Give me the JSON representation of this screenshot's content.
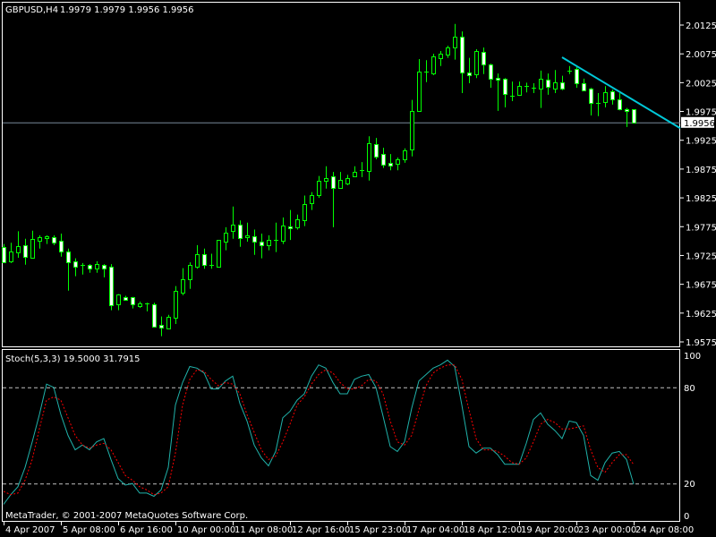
{
  "header": {
    "symbol_timeframe": "GBPUSD,H4",
    "ohlc_text": "1.9979 1.9979 1.9956 1.9956"
  },
  "indicator": {
    "label": "Stoch(5,3,3) 19.5000 31.7915"
  },
  "copyright": "MetaTrader, © 2001-2007 MetaQuotes Software Corp.",
  "colors": {
    "background": "#000000",
    "frame": "#ffffff",
    "candle_outline": "#00ff00",
    "bull_body": "#000000",
    "bear_body": "#ffffff",
    "trendline": "#00c8d8",
    "bid_line": "#778899",
    "stoch_main": "#20b2aa",
    "stoch_signal": "#ff0000",
    "level_line": "#c0c0c0"
  },
  "chart_data": [
    {
      "type": "candlestick",
      "title": "GBPUSD,H4",
      "ylim": [
        1.9575,
        2.0125
      ],
      "price_ticks": [
        "2.0125",
        "2.0075",
        "2.0025",
        "1.9975",
        "1.9925",
        "1.9875",
        "1.9825",
        "1.9775",
        "1.9725",
        "1.9675",
        "1.9625",
        "1.9575"
      ],
      "current_price": "1.9956",
      "time_labels": [
        {
          "bar": 0,
          "text": "4 Apr 2007"
        },
        {
          "bar": 8,
          "text": "5 Apr 08:00"
        },
        {
          "bar": 16,
          "text": "6 Apr 16:00"
        },
        {
          "bar": 24,
          "text": "10 Apr 00:00"
        },
        {
          "bar": 32,
          "text": "11 Apr 08:00"
        },
        {
          "bar": 40,
          "text": "12 Apr 16:00"
        },
        {
          "bar": 48,
          "text": "15 Apr 23:00"
        },
        {
          "bar": 56,
          "text": "17 Apr 04:00"
        },
        {
          "bar": 64,
          "text": "18 Apr 12:00"
        },
        {
          "bar": 72,
          "text": "19 Apr 20:00"
        },
        {
          "bar": 80,
          "text": "23 Apr 00:00"
        },
        {
          "bar": 88,
          "text": "24 Apr 08:00"
        }
      ],
      "ohlc_fields": [
        "open",
        "high",
        "low",
        "close"
      ],
      "candles": [
        [
          1.974,
          1.9745,
          1.9713,
          1.9713
        ],
        [
          1.9715,
          1.9747,
          1.9712,
          1.9732
        ],
        [
          1.973,
          1.9767,
          1.9721,
          1.9742
        ],
        [
          1.9743,
          1.9754,
          1.9709,
          1.9723
        ],
        [
          1.9721,
          1.9768,
          1.9721,
          1.9754
        ],
        [
          1.9751,
          1.976,
          1.9737,
          1.9757
        ],
        [
          1.9756,
          1.976,
          1.9745,
          1.9759
        ],
        [
          1.9757,
          1.976,
          1.9743,
          1.9748
        ],
        [
          1.9751,
          1.9763,
          1.9723,
          1.9732
        ],
        [
          1.9732,
          1.9737,
          1.9664,
          1.9713
        ],
        [
          1.9715,
          1.972,
          1.9689,
          1.9705
        ],
        [
          1.9708,
          1.9712,
          1.9692,
          1.9708
        ],
        [
          1.9708,
          1.971,
          1.9695,
          1.9703
        ],
        [
          1.9702,
          1.9715,
          1.9695,
          1.971
        ],
        [
          1.9709,
          1.971,
          1.9687,
          1.9702
        ],
        [
          1.9705,
          1.971,
          1.963,
          1.9639
        ],
        [
          1.964,
          1.9658,
          1.963,
          1.9658
        ],
        [
          1.9653,
          1.9655,
          1.9647,
          1.9648
        ],
        [
          1.9653,
          1.9653,
          1.9633,
          1.964
        ],
        [
          1.9637,
          1.9645,
          1.9634,
          1.9642
        ],
        [
          1.9642,
          1.9643,
          1.9628,
          1.9642
        ],
        [
          1.964,
          1.9643,
          1.9602,
          1.9602
        ],
        [
          1.9605,
          1.9619,
          1.9585,
          1.96
        ],
        [
          1.9599,
          1.9622,
          1.9599,
          1.9619
        ],
        [
          1.9617,
          1.9672,
          1.9606,
          1.9664
        ],
        [
          1.9661,
          1.9703,
          1.9656,
          1.9684
        ],
        [
          1.9683,
          1.9713,
          1.9667,
          1.9709
        ],
        [
          1.9706,
          1.9743,
          1.9702,
          1.9728
        ],
        [
          1.9728,
          1.9737,
          1.9702,
          1.9708
        ],
        [
          1.9709,
          1.9728,
          1.9702,
          1.9709
        ],
        [
          1.9706,
          1.9752,
          1.9705,
          1.9752
        ],
        [
          1.9749,
          1.9774,
          1.9734,
          1.9765
        ],
        [
          1.9767,
          1.981,
          1.9754,
          1.9779
        ],
        [
          1.9779,
          1.9786,
          1.974,
          1.9756
        ],
        [
          1.9757,
          1.9782,
          1.9749,
          1.976
        ],
        [
          1.9759,
          1.977,
          1.9726,
          1.9749
        ],
        [
          1.9749,
          1.9763,
          1.972,
          1.9743
        ],
        [
          1.9743,
          1.976,
          1.9734,
          1.9752
        ],
        [
          1.9752,
          1.9782,
          1.9731,
          1.9752
        ],
        [
          1.9751,
          1.9791,
          1.9745,
          1.9777
        ],
        [
          1.9776,
          1.9804,
          1.9752,
          1.9773
        ],
        [
          1.9774,
          1.9796,
          1.977,
          1.9788
        ],
        [
          1.9787,
          1.9829,
          1.9776,
          1.9814
        ],
        [
          1.9816,
          1.9835,
          1.9804,
          1.983
        ],
        [
          1.983,
          1.9863,
          1.9825,
          1.9855
        ],
        [
          1.9855,
          1.988,
          1.9841,
          1.9859
        ],
        [
          1.9862,
          1.987,
          1.9774,
          1.9842
        ],
        [
          1.9842,
          1.987,
          1.9841,
          1.9856
        ],
        [
          1.985,
          1.9865,
          1.9847,
          1.9859
        ],
        [
          1.9862,
          1.988,
          1.9862,
          1.987
        ],
        [
          1.9873,
          1.9887,
          1.9861,
          1.9873
        ],
        [
          1.9872,
          1.9932,
          1.9855,
          1.992
        ],
        [
          1.9919,
          1.9929,
          1.9892,
          1.9897
        ],
        [
          1.9901,
          1.9912,
          1.9877,
          1.9883
        ],
        [
          1.9886,
          1.9901,
          1.9873,
          1.9881
        ],
        [
          1.9884,
          1.9895,
          1.9873,
          1.9892
        ],
        [
          1.9892,
          1.9911,
          1.9886,
          1.9908
        ],
        [
          1.9909,
          1.9995,
          1.9897,
          1.9976
        ],
        [
          1.9976,
          2.0066,
          1.9976,
          2.0044
        ],
        [
          2.0044,
          2.0064,
          2.0026,
          2.0044
        ],
        [
          2.0041,
          2.0075,
          2.0038,
          2.0071
        ],
        [
          2.0068,
          2.008,
          2.0054,
          2.0075
        ],
        [
          2.0074,
          2.0089,
          2.0068,
          2.0086
        ],
        [
          2.0086,
          2.0127,
          2.0065,
          2.0105
        ],
        [
          2.0105,
          2.0114,
          2.0007,
          2.0043
        ],
        [
          2.0043,
          2.0068,
          2.0024,
          2.0038
        ],
        [
          2.004,
          2.0083,
          2.0033,
          2.008
        ],
        [
          2.0078,
          2.0086,
          2.004,
          2.0057
        ],
        [
          2.0057,
          2.0058,
          2.0016,
          2.0032
        ],
        [
          2.0033,
          2.0041,
          1.9976,
          2.003
        ],
        [
          2.0032,
          2.0033,
          1.9982,
          2.0005
        ],
        [
          2.0002,
          2.0027,
          1.9993,
          2.0002
        ],
        [
          2.0004,
          2.0027,
          2.0002,
          2.0019
        ],
        [
          2.0019,
          2.0025,
          2.0008,
          2.0019
        ],
        [
          2.0016,
          2.0024,
          2.0007,
          2.0016
        ],
        [
          2.0015,
          2.0046,
          1.9981,
          2.0032
        ],
        [
          2.003,
          2.0041,
          2.0004,
          2.0018
        ],
        [
          2.0015,
          2.0047,
          2.0007,
          2.0026
        ],
        [
          2.0026,
          2.0037,
          2.0012,
          2.0015
        ],
        [
          2.0046,
          2.0054,
          2.004,
          2.0046
        ],
        [
          2.0049,
          2.0052,
          2.0016,
          2.0024
        ],
        [
          2.0024,
          2.0032,
          2.0012,
          2.0012
        ],
        [
          2.0015,
          2.0016,
          1.9968,
          1.999
        ],
        [
          1.999,
          2.0007,
          1.9967,
          1.999
        ],
        [
          1.9991,
          2.0019,
          1.9982,
          2.0008
        ],
        [
          2.001,
          2.0013,
          1.9987,
          1.9996
        ],
        [
          1.9996,
          2.0007,
          1.9977,
          1.9979
        ],
        [
          1.9979,
          1.9981,
          1.9948,
          1.9976
        ],
        [
          1.9979,
          1.9979,
          1.9956,
          1.9956
        ]
      ],
      "trendline": {
        "start": {
          "bar": 78,
          "price": 2.0069
        },
        "end": {
          "bar": 94.5,
          "price": 1.9946
        }
      }
    },
    {
      "type": "line",
      "title": "Stoch(5,3,3)",
      "ylim": [
        0,
        100
      ],
      "y_ticks": [
        "100",
        "80",
        "20",
        "0"
      ],
      "levels": [
        80,
        20
      ],
      "series": [
        {
          "name": "Main",
          "values": [
            7,
            13,
            18,
            30,
            46,
            63,
            82,
            80,
            63,
            50,
            41,
            44,
            41,
            46,
            48,
            35,
            23,
            19,
            20,
            14,
            14,
            12,
            16,
            30,
            69,
            83,
            93,
            92,
            89,
            79,
            79,
            84,
            87,
            70,
            59,
            44,
            36,
            31,
            40,
            61,
            65,
            72,
            76,
            87,
            94,
            92,
            83,
            76,
            76,
            85,
            87,
            88,
            80,
            62,
            43,
            40,
            46,
            67,
            84,
            88,
            92,
            94,
            97,
            93,
            69,
            43,
            39,
            42,
            42,
            38,
            32,
            32,
            32,
            45,
            60,
            64,
            57,
            53,
            48,
            59,
            58,
            50,
            25,
            22,
            33,
            39,
            40,
            35,
            19.5
          ]
        },
        {
          "name": "Signal",
          "values": [
            15,
            13,
            14,
            22,
            35,
            54,
            72,
            74,
            72,
            61,
            50,
            44,
            42,
            44,
            45,
            41,
            33,
            25,
            22,
            18,
            16,
            13,
            14,
            18,
            39,
            69,
            85,
            91,
            90,
            85,
            81,
            83,
            82,
            76,
            63,
            52,
            41,
            35,
            37,
            46,
            57,
            69,
            74,
            82,
            88,
            91,
            89,
            83,
            79,
            79,
            81,
            85,
            84,
            76,
            59,
            46,
            44,
            50,
            66,
            81,
            89,
            92,
            94,
            94,
            85,
            66,
            48,
            41,
            41,
            40,
            37,
            33,
            32,
            36,
            46,
            57,
            60,
            58,
            54,
            54,
            55,
            56,
            41,
            30,
            27,
            33,
            38,
            38,
            31.79
          ]
        }
      ]
    }
  ]
}
